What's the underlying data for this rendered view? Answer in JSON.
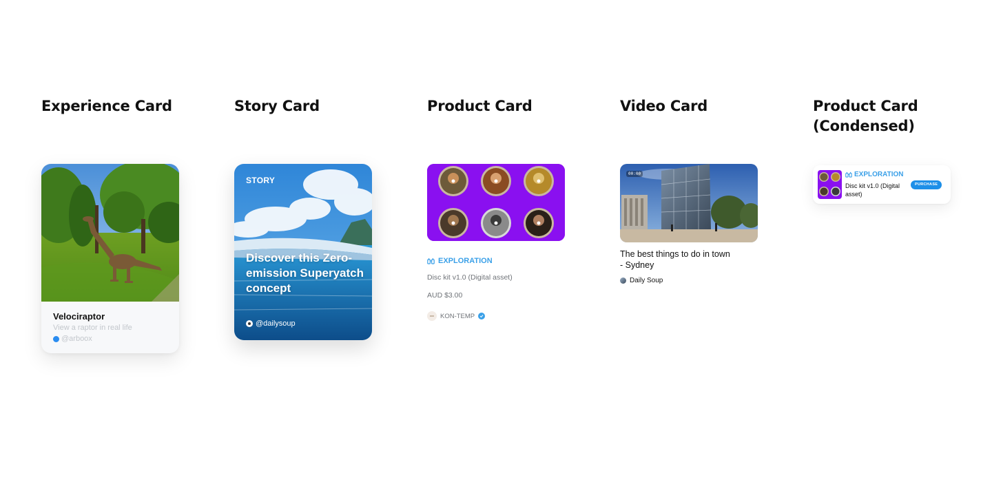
{
  "sections": {
    "experience": "Experience Card",
    "story": "Story Card",
    "product": "Product Card",
    "video": "Video Card",
    "product_condensed": "Product Card (Condensed)"
  },
  "experience_card": {
    "title": "Velociraptor",
    "subtitle": "View a raptor in real life",
    "author": "@arboox"
  },
  "story_card": {
    "tag": "STORY",
    "headline": "Discover this Zero-emission Superyatch concept",
    "author": "@dailysoup"
  },
  "product_card": {
    "category": "EXPLORATION",
    "name": "Disc kit v1.0 (Digital asset)",
    "price": "AUD $3.00",
    "seller": "KON-TEMP",
    "accent_color": "#8a10f0"
  },
  "video_card": {
    "timestamp": "00:00",
    "title": "The best things to do in town - Sydney",
    "channel": "Daily Soup"
  },
  "product_card_condensed": {
    "category": "EXPLORATION",
    "name": "Disc kit v1.0 (Digital asset)",
    "purchase_label": "PURCHASE"
  },
  "icons": {
    "category": "binoculars-icon",
    "verified": "verified-check-icon"
  }
}
